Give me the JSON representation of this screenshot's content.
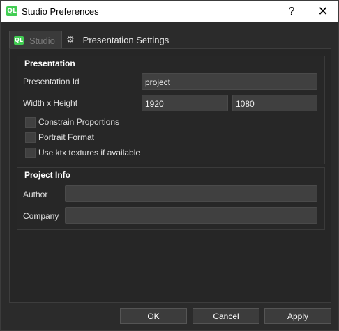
{
  "window": {
    "title": "Studio Preferences",
    "app_icon_text": "QL",
    "help_label": "?",
    "close_label": "✕"
  },
  "tabs": [
    {
      "label": "Studio",
      "icon": "qt-logo-icon",
      "icon_text": "QL"
    },
    {
      "label": "Presentation Settings",
      "icon": "gear-icon",
      "icon_text": "⚙"
    }
  ],
  "presentation": {
    "title": "Presentation",
    "id_label": "Presentation Id",
    "id_value": "project",
    "size_label": "Width x Height",
    "width_value": "1920",
    "height_value": "1080",
    "options": [
      {
        "label": "Constrain Proportions",
        "checked": false
      },
      {
        "label": "Portrait Format",
        "checked": false
      },
      {
        "label": "Use ktx textures if available",
        "checked": false
      }
    ]
  },
  "project_info": {
    "title": "Project Info",
    "author_label": "Author",
    "author_value": "",
    "company_label": "Company",
    "company_value": ""
  },
  "buttons": {
    "ok": "OK",
    "cancel": "Cancel",
    "apply": "Apply"
  },
  "colors": {
    "background": "#2b2b2b",
    "panel": "#262626",
    "input": "#404040",
    "qt_green": "#41cd52"
  }
}
